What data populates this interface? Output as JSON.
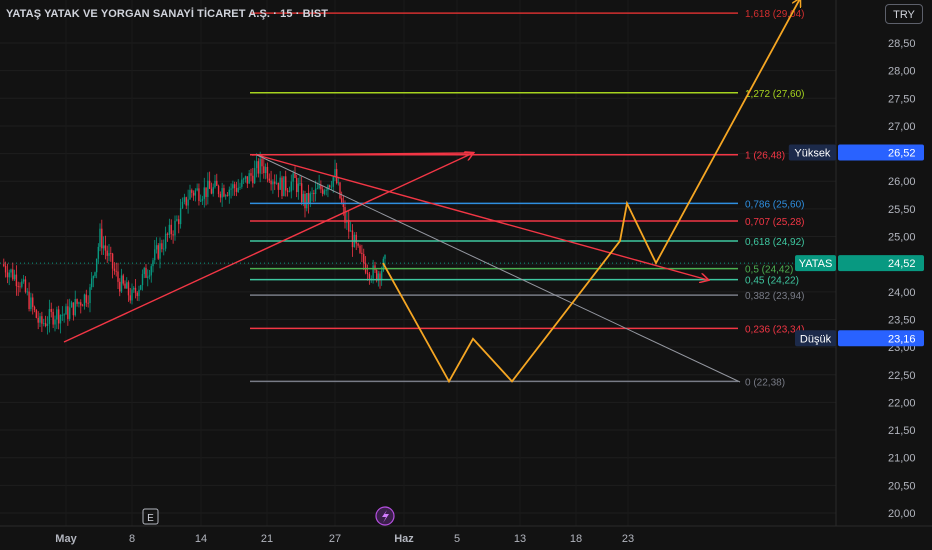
{
  "header": {
    "title": "YATAŞ YATAK VE YORGAN SANAYİ TİCARET A.Ş. · 15 · BIST",
    "currency": "TRY"
  },
  "colors": {
    "background": "#121212",
    "up": "#089981",
    "down": "#f23645",
    "fib_red": "#f23645",
    "fib_green": "#4caf50",
    "fib_lime": "#a6d31f",
    "fib_blue": "#2f8fe0",
    "fib_teal": "#3ec7a0",
    "path": "#f5a623",
    "arrow": "#f23645"
  },
  "chart_data": {
    "type": "candlestick",
    "y_axis": {
      "range": [
        19.92,
        29.3
      ],
      "ticks": [
        "28,50",
        "28,00",
        "27,50",
        "27,00",
        "26,50",
        "26,00",
        "25,50",
        "25,00",
        "24,50",
        "24,00",
        "23,50",
        "23,00",
        "22,50",
        "22,00",
        "21,50",
        "21,00",
        "20,50",
        "20,00"
      ]
    },
    "x_axis": {
      "ticks": [
        "May",
        "8",
        "14",
        "21",
        "27",
        "Haz",
        "5",
        "13",
        "18",
        "23"
      ]
    },
    "price_series": {
      "name": "YATAS",
      "points": [
        [
          "May-02",
          24.5
        ],
        [
          "May-03",
          24.2
        ],
        [
          "May-06",
          23.4
        ],
        [
          "May-07",
          23.6
        ],
        [
          "May-08",
          23.6
        ],
        [
          "May-09",
          24.0
        ],
        [
          "May-10",
          25.0
        ],
        [
          "May-13",
          24.2
        ],
        [
          "May-14",
          23.9
        ],
        [
          "May-15",
          24.8
        ],
        [
          "May-16",
          25.2
        ],
        [
          "May-17",
          25.8
        ],
        [
          "May-20",
          25.9
        ],
        [
          "May-21",
          26.3
        ],
        [
          "May-22",
          25.9
        ],
        [
          "May-23",
          26.0
        ],
        [
          "May-24",
          25.6
        ],
        [
          "May-27",
          26.1
        ],
        [
          "May-28",
          25.3
        ],
        [
          "May-29",
          24.6
        ],
        [
          "May-30",
          24.3
        ],
        [
          "May-31",
          24.5
        ]
      ]
    },
    "fibonacci": [
      {
        "level": "1,618",
        "value": 29.04,
        "label": "1,618 (29,04)",
        "color": "#d32f2f"
      },
      {
        "level": "1,272",
        "value": 27.6,
        "label": "1,272 (27,60)",
        "color": "#a6d31f"
      },
      {
        "level": "1",
        "value": 26.48,
        "label": "1 (26,48)",
        "color": "#f23645"
      },
      {
        "level": "0,786",
        "value": 25.6,
        "label": "0,786 (25,60)",
        "color": "#2f8fe0"
      },
      {
        "level": "0,707",
        "value": 25.28,
        "label": "0,707 (25,28)",
        "color": "#f23645"
      },
      {
        "level": "0,618",
        "value": 24.92,
        "label": "0,618 (24,92)",
        "color": "#3ec7a0"
      },
      {
        "level": "0,5",
        "value": 24.42,
        "label": "0,5 (24,42)",
        "color": "#4caf50"
      },
      {
        "level": "0,45",
        "value": 24.22,
        "label": "0,45 (24,22)",
        "color": "#3ec7a0"
      },
      {
        "level": "0,382",
        "value": 23.94,
        "label": "0,382 (23,94)",
        "color": "#787b86"
      },
      {
        "level": "0,236",
        "value": 23.34,
        "label": "0,236 (23,34)",
        "color": "#f23645"
      },
      {
        "level": "0",
        "value": 22.38,
        "label": "0 (22,38)",
        "color": "#787b86"
      }
    ],
    "projection_path_values": [
      24.52,
      22.38,
      23.15,
      22.38,
      24.92,
      25.6,
      24.52,
      29.3
    ],
    "price_tags": [
      {
        "name": "Yüksek",
        "value": "26,52",
        "y_value": 26.52,
        "color": "#2962ff",
        "name_bg": "#1c2a4a"
      },
      {
        "name": "YATAS",
        "value": "24,52",
        "y_value": 24.52,
        "color": "#089981",
        "name_bg": "#089981"
      },
      {
        "name": "Düşük",
        "value": "23,16",
        "y_value": 23.16,
        "color": "#2962ff",
        "name_bg": "#1c2a4a"
      }
    ],
    "markers": {
      "earnings": "E",
      "dividend_icon": "lightning-icon"
    }
  }
}
